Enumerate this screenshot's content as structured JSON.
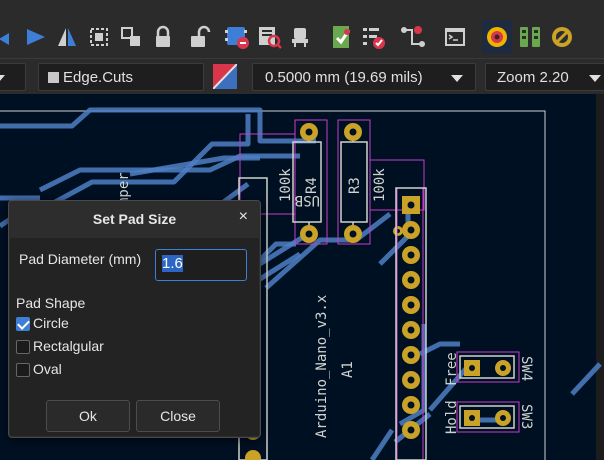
{
  "toolbar": {
    "layer_select": "Edge.Cuts",
    "track_width": "0.5000 mm (19.69 mils)",
    "zoom": "Zoom 2.20"
  },
  "pcb": {
    "silkscreen": {
      "jumper": "mper",
      "r4_value": "100k",
      "r4_ref": "R4",
      "r3_ref": "R3",
      "r3_value": "100k",
      "usb": "USB",
      "arduino": "Arduino_Nano_v3.x",
      "a1": "A1",
      "free": "Free",
      "hold": "Hold",
      "sw4": "SW4",
      "sw3": "SW3",
      "edge_char": "x"
    }
  },
  "dialog": {
    "title": "Set Pad Size",
    "close_glyph": "×",
    "diameter_label": "Pad Diameter (mm)",
    "diameter_value": "1.6",
    "shape_label": "Pad Shape",
    "options": [
      {
        "label": "Circle",
        "checked": true
      },
      {
        "label": "Rectalgular",
        "checked": false
      },
      {
        "label": "Oval",
        "checked": false
      }
    ],
    "ok_label": "Ok",
    "close_label": "Close"
  }
}
